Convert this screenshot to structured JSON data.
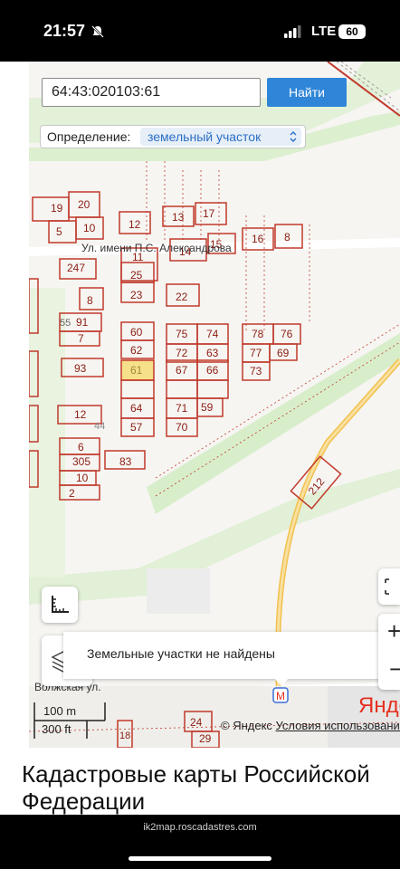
{
  "status_bar": {
    "time": "21:57",
    "network": "LTE",
    "battery": "60"
  },
  "search": {
    "value": "64:43:020103:61",
    "find_label": "Найти"
  },
  "definition": {
    "label": "Определение:",
    "selected": "земельный участок"
  },
  "map": {
    "street_label": "Ул. имени П.С. Александрова",
    "street_label_2": "Волжская ул.",
    "not_found_message": "Земельные участки не найдены",
    "scale_100": "100 m",
    "scale_300": "300 ft",
    "copyright": "© Яндекс",
    "terms": "Условия использования",
    "brand": "Янде",
    "zoom_in": "+",
    "zoom_out": "−",
    "parcel_labels": [
      "19",
      "20",
      "10",
      "5",
      "12",
      "13",
      "17",
      "15",
      "14",
      "16",
      "8",
      "11",
      "247",
      "25",
      "23",
      "22",
      "8",
      "91",
      "55",
      "7",
      "60",
      "75",
      "74",
      "78",
      "76",
      "62",
      "72",
      "63",
      "77",
      "69",
      "61",
      "67",
      "66",
      "73",
      "93",
      "12",
      "64",
      "71",
      "59",
      "57",
      "70",
      "44",
      "6",
      "305",
      "83",
      "10",
      "2",
      "212",
      "18",
      "24",
      "29"
    ]
  },
  "page": {
    "title": "Кадастровые карты Российской Федерации",
    "url": "ik2map.roscadastres.com"
  },
  "colors": {
    "parcel": "#c0392b",
    "highlight": "#f7e08a",
    "accent": "#2f86d8"
  }
}
